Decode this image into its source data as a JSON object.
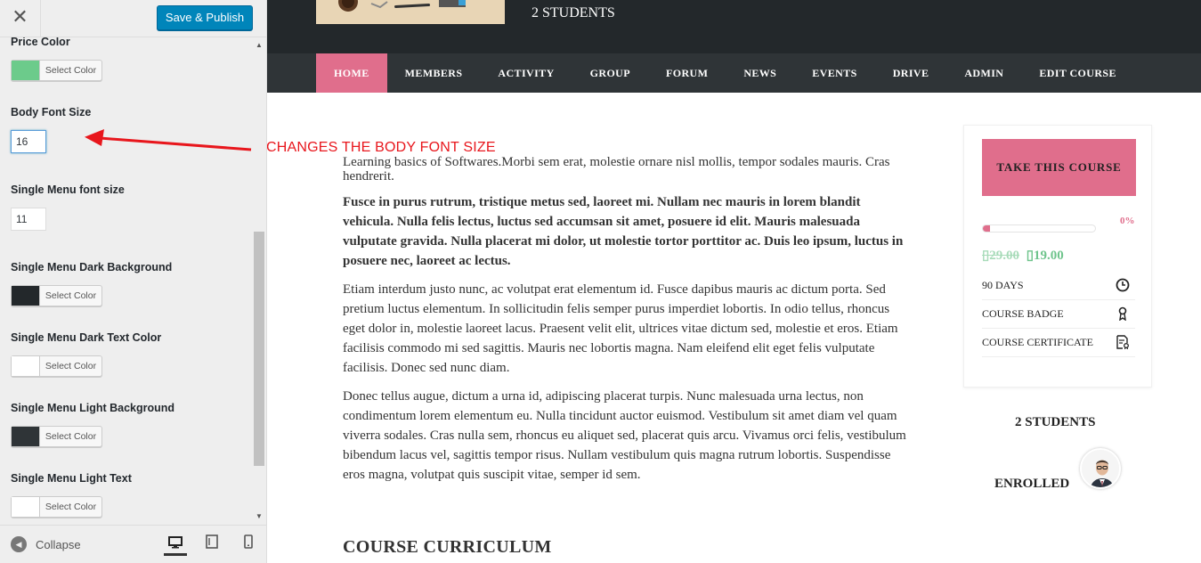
{
  "sidebar": {
    "close_icon": "close-icon",
    "publish_label": "Save & Publish",
    "controls": [
      {
        "label": "Price Color",
        "type": "color",
        "swatch": "#6ccb8b",
        "button": "Select Color"
      },
      {
        "label": "Body Font Size",
        "type": "number",
        "value": "16"
      },
      {
        "label": "Single Menu font size",
        "type": "number",
        "value": "11"
      },
      {
        "label": "Single Menu Dark Background",
        "type": "color",
        "swatch": "#23282b",
        "button": "Select Color"
      },
      {
        "label": "Single Menu Dark Text Color",
        "type": "color",
        "swatch": "#ffffff",
        "button": "Select Color"
      },
      {
        "label": "Single Menu Light Background",
        "type": "color",
        "swatch": "#2f3437",
        "button": "Select Color"
      },
      {
        "label": "Single Menu Light Text",
        "type": "color",
        "swatch": "#ffffff",
        "button": "Select Color"
      }
    ],
    "footer": {
      "collapse_label": "Collapse",
      "devices": [
        "desktop-icon",
        "tablet-icon",
        "mobile-icon"
      ]
    }
  },
  "annotation": {
    "text": "CHANGES THE BODY FONT SIZE",
    "color": "#e8161c"
  },
  "preview": {
    "header_students": "2 STUDENTS",
    "nav": [
      "HOME",
      "MEMBERS",
      "ACTIVITY",
      "GROUP",
      "FORUM",
      "NEWS",
      "EVENTS",
      "DRIVE",
      "ADMIN",
      "EDIT COURSE"
    ],
    "nav_active": "HOME",
    "accent": "#e06e8c",
    "price_color": "#6fc48c",
    "content": {
      "intro": "Learning basics of Softwares.Morbi sem erat, molestie ornare nisl mollis, tempor sodales mauris. Cras hendrerit.",
      "bold": "Fusce in purus rutrum, tristique metus sed, laoreet mi. Nullam nec mauris in lorem blandit vehicula. Nulla felis lectus, luctus sed accumsan sit amet, posuere id elit. Mauris malesuada vulputate gravida. Nulla placerat mi dolor, ut molestie tortor porttitor ac. Duis leo ipsum, luctus in posuere nec, laoreet ac lectus.",
      "p1": "Etiam interdum justo nunc, ac volutpat erat elementum id. Fusce dapibus mauris ac dictum porta. Sed pretium luctus elementum. In sollicitudin felis semper purus imperdiet lobortis. In odio tellus, rhoncus eget dolor in, molestie laoreet lacus. Praesent velit elit, ultrices vitae dictum sed, molestie et eros. Etiam facilisis commodo mi sed sagittis. Mauris nec lobortis magna. Nam eleifend elit eget felis vulputate facilisis. Donec sed nunc diam.",
      "p2": "Donec tellus augue, dictum a urna id, adipiscing placerat turpis. Nunc malesuada urna lectus, non condimentum lorem elementum eu. Nulla tincidunt auctor euismod. Vestibulum sit amet diam vel quam viverra sodales. Cras nulla sem, rhoncus eu aliquet sed, placerat quis arcu. Vivamus orci felis, vestibulum bibendum lacus vel, sagittis tempor risus. Nullam vestibulum quis magna rutrum lobortis. Suspendisse eros magna, volutpat quis suscipit vitae, semper id sem.",
      "curriculum_title": "COURSE CURRICULUM"
    },
    "course_box": {
      "take_label": "TAKE THIS COURSE",
      "progress_value": 0,
      "progress_label": "0%",
      "price_old": "▯29.00",
      "price_new": "▯19.00",
      "features": [
        {
          "label": "90 DAYS",
          "icon": "clock-icon"
        },
        {
          "label": "COURSE BADGE",
          "icon": "badge-icon"
        },
        {
          "label": "COURSE CERTIFICATE",
          "icon": "certificate-icon"
        }
      ]
    },
    "students_side": "2 STUDENTS",
    "enrolled": "ENROLLED"
  }
}
